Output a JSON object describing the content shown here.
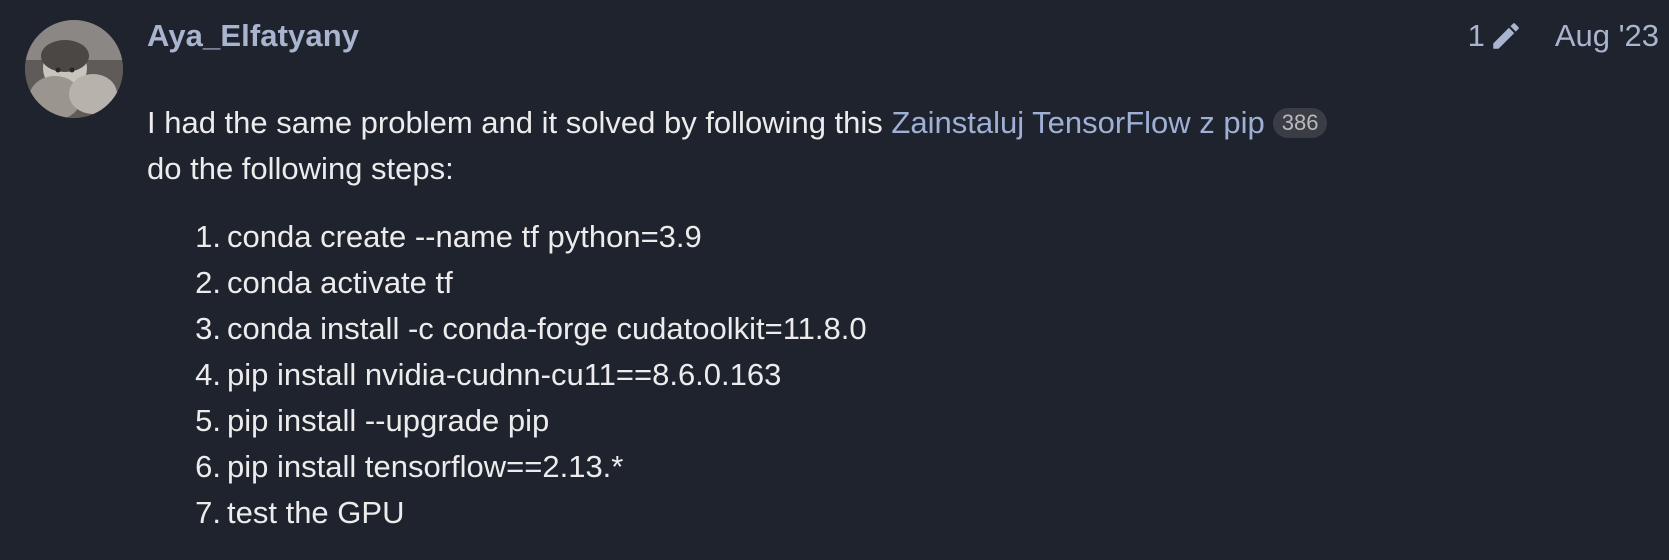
{
  "post": {
    "username": "Aya_Elfatyany",
    "edit_count": "1",
    "date": "Aug '23",
    "intro_text": "I had the same problem and it solved by following this ",
    "link_text": "Zainstaluj TensorFlow z pip",
    "link_clicks": "386",
    "steps_intro": "do the following steps:",
    "steps": [
      {
        "num": "1.",
        "text": "conda create --name tf python=3.9"
      },
      {
        "num": "2.",
        "text": "conda activate tf"
      },
      {
        "num": "3.",
        "text": "conda install -c conda-forge cudatoolkit=11.8.0"
      },
      {
        "num": "4.",
        "text": "pip install nvidia-cudnn-cu11==8.6.0.163"
      },
      {
        "num": "5.",
        "text": "pip install --upgrade pip"
      },
      {
        "num": "6.",
        "text": "pip install tensorflow==2.13.*"
      },
      {
        "num": "7.",
        "text": "test the GPU"
      }
    ]
  },
  "icons": {
    "edit": "pencil-icon"
  },
  "colors": {
    "background": "#1f232d",
    "username": "#a9b4cf",
    "link": "#9fb0d6",
    "text": "#ececec",
    "badge_bg": "#3a3d45"
  }
}
